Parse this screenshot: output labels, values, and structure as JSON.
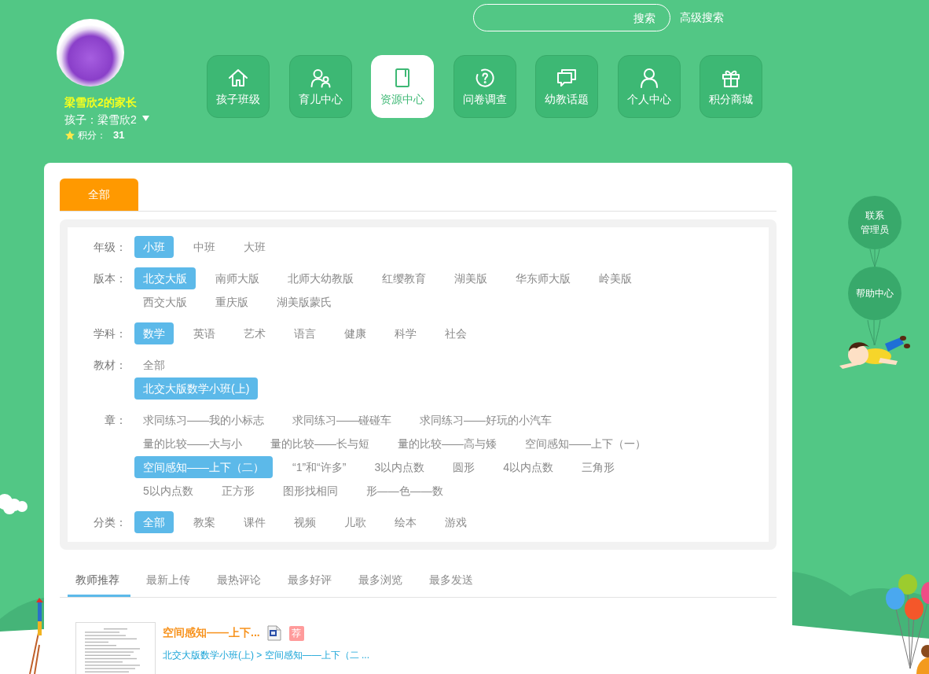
{
  "user": {
    "name": "梁雪欣2的家长",
    "child": "孩子：梁雪欣2",
    "points_label": "积分：",
    "points": "31"
  },
  "search": {
    "button": "搜索"
  },
  "advanced_search": "高级搜索",
  "nav": [
    {
      "label": "孩子班级",
      "selected": false
    },
    {
      "label": "育儿中心",
      "selected": false
    },
    {
      "label": "资源中心",
      "selected": true
    },
    {
      "label": "问卷调查",
      "selected": false
    },
    {
      "label": "幼教话题",
      "selected": false
    },
    {
      "label": "个人中心",
      "selected": false
    },
    {
      "label": "积分商城",
      "selected": false
    }
  ],
  "main_tabs": [
    {
      "label": "全部",
      "selected": true
    }
  ],
  "filters": [
    {
      "label": "年级：",
      "kind": "inline",
      "options": [
        {
          "label": "小班",
          "selected": true
        },
        {
          "label": "中班",
          "selected": false
        },
        {
          "label": "大班",
          "selected": false
        }
      ]
    },
    {
      "label": "版本：",
      "kind": "inline",
      "options": [
        {
          "label": "北交大版",
          "selected": true
        },
        {
          "label": "南师大版",
          "selected": false
        },
        {
          "label": "北师大幼教版",
          "selected": false
        },
        {
          "label": "红缨教育",
          "selected": false
        },
        {
          "label": "湖美版",
          "selected": false
        },
        {
          "label": "华东师大版",
          "selected": false
        },
        {
          "label": "岭美版",
          "selected": false
        },
        {
          "label": "西交大版",
          "selected": false
        },
        {
          "label": "重庆版",
          "selected": false
        },
        {
          "label": "湖美版蒙氏",
          "selected": false
        }
      ]
    },
    {
      "label": "学科：",
      "kind": "inline",
      "options": [
        {
          "label": "数学",
          "selected": true
        },
        {
          "label": "英语",
          "selected": false
        },
        {
          "label": "艺术",
          "selected": false
        },
        {
          "label": "语言",
          "selected": false
        },
        {
          "label": "健康",
          "selected": false
        },
        {
          "label": "科学",
          "selected": false
        },
        {
          "label": "社会",
          "selected": false
        }
      ]
    },
    {
      "label": "教材：",
      "kind": "stacked",
      "options": [
        {
          "label": "全部",
          "selected": false
        },
        {
          "label": "北交大版数学小班(上)",
          "selected": true
        }
      ]
    },
    {
      "label": "章：",
      "kind": "inline",
      "options": [
        {
          "label": "求同练习——我的小标志",
          "selected": false
        },
        {
          "label": "求同练习——碰碰车",
          "selected": false
        },
        {
          "label": "求同练习——好玩的小汽车",
          "selected": false
        },
        {
          "label": "量的比较——大与小",
          "selected": false
        },
        {
          "label": "量的比较——长与短",
          "selected": false
        },
        {
          "label": "量的比较——高与矮",
          "selected": false
        },
        {
          "label": "空间感知——上下（一）",
          "selected": false
        },
        {
          "label": "空间感知——上下（二）",
          "selected": true
        },
        {
          "label": "“1”和“许多”",
          "selected": false
        },
        {
          "label": "3以内点数",
          "selected": false
        },
        {
          "label": "圆形",
          "selected": false
        },
        {
          "label": "4以内点数",
          "selected": false
        },
        {
          "label": "三角形",
          "selected": false
        },
        {
          "label": "5以内点数",
          "selected": false
        },
        {
          "label": "正方形",
          "selected": false
        },
        {
          "label": "图形找相同",
          "selected": false
        },
        {
          "label": "形——色——数",
          "selected": false
        }
      ]
    },
    {
      "label": "分类：",
      "kind": "inline",
      "options": [
        {
          "label": "全部",
          "selected": true
        },
        {
          "label": "教案",
          "selected": false
        },
        {
          "label": "课件",
          "selected": false
        },
        {
          "label": "视频",
          "selected": false
        },
        {
          "label": "儿歌",
          "selected": false
        },
        {
          "label": "绘本",
          "selected": false
        },
        {
          "label": "游戏",
          "selected": false
        }
      ]
    }
  ],
  "sort_tabs": [
    {
      "label": "教师推荐",
      "selected": true
    },
    {
      "label": "最新上传",
      "selected": false
    },
    {
      "label": "最热评论",
      "selected": false
    },
    {
      "label": "最多好评",
      "selected": false
    },
    {
      "label": "最多浏览",
      "selected": false
    },
    {
      "label": "最多发送",
      "selected": false
    }
  ],
  "resources": [
    {
      "title": "空间感知——上下...",
      "badge": "荐",
      "path": "北交大版数学小班(上) > 空间感知——上下（二 ..."
    }
  ],
  "side_buttons": [
    {
      "lines": [
        "联系",
        "管理员"
      ]
    },
    {
      "lines": [
        "帮助中心"
      ]
    }
  ]
}
